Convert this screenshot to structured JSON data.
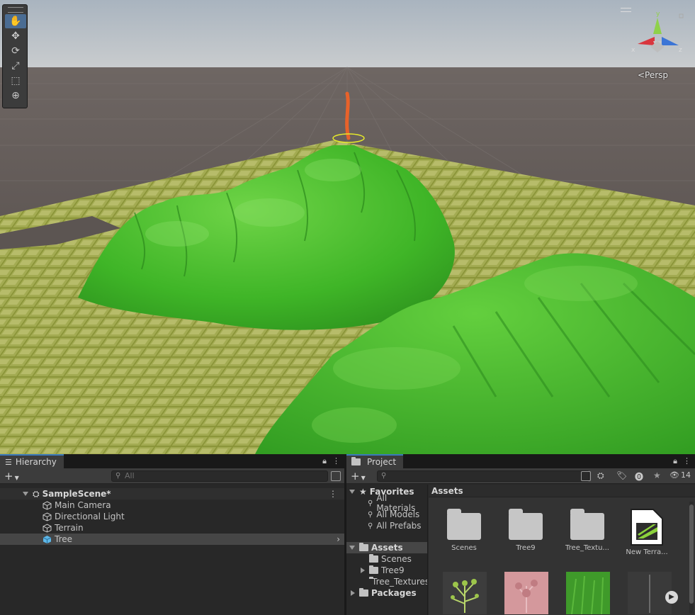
{
  "scene_view": {
    "tools": [
      "hand-tool",
      "move-tool",
      "rotate-tool",
      "scale-tool",
      "rect-tool",
      "transform-tool"
    ],
    "active_tool": "hand-tool",
    "gizmo": {
      "y": "y",
      "x": "x",
      "z": "z"
    },
    "projection_label": "<Persp"
  },
  "hierarchy": {
    "tab_label": "Hierarchy",
    "search_placeholder": "All",
    "scene_name": "SampleScene*",
    "items": [
      {
        "label": "Main Camera",
        "icon": "gameobject-icon"
      },
      {
        "label": "Directional Light",
        "icon": "gameobject-icon"
      },
      {
        "label": "Terrain",
        "icon": "gameobject-icon"
      },
      {
        "label": "Tree",
        "icon": "prefab-icon",
        "selected": true
      }
    ]
  },
  "project": {
    "tab_label": "Project",
    "hidden_count": "14",
    "favorites": {
      "label": "Favorites",
      "items": [
        "All Materials",
        "All Models",
        "All Prefabs"
      ]
    },
    "assets_tree": {
      "label": "Assets",
      "children": [
        "Scenes",
        "Tree9",
        "Tree_Textures"
      ]
    },
    "packages_label": "Packages",
    "breadcrumb": "Assets",
    "grid": [
      {
        "label": "Scenes",
        "type": "folder"
      },
      {
        "label": "Tree9",
        "type": "folder"
      },
      {
        "label": "Tree_Textu...",
        "type": "folder"
      },
      {
        "label": "New Terra...",
        "type": "terrain-data"
      }
    ]
  },
  "colors": {
    "accent_blue": "#3a79bb",
    "selection": "#464646",
    "terrain_green": "#3fbf2a"
  }
}
